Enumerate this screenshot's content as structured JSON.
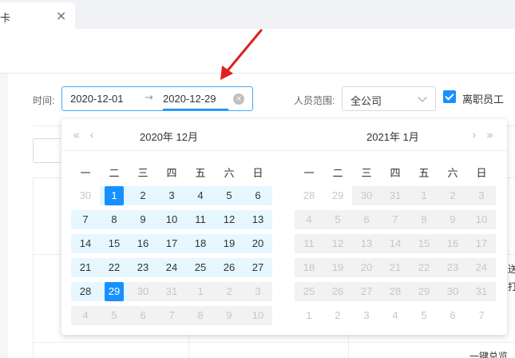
{
  "tab": {
    "label": "卡",
    "close": "×"
  },
  "filters": {
    "time_label": "时间:",
    "start": "2020-12-01",
    "arrow": "→",
    "end": "2020-12-29",
    "clear_icon": "×",
    "scope_label": "人员范围:",
    "scope_value": "全公司",
    "checkbox_label": "离职员工"
  },
  "calendar": {
    "nav_prev_year": "«",
    "nav_prev_month": "‹",
    "nav_next_month": "›",
    "nav_next_year": "»",
    "left_title": "2020年  12月",
    "right_title": "2021年  1月",
    "weekdays": [
      "一",
      "二",
      "三",
      "四",
      "五",
      "六",
      "日"
    ],
    "left_weeks": [
      [
        {
          "d": "30",
          "k": "out"
        },
        {
          "d": "1",
          "k": "sel"
        },
        {
          "d": "2",
          "k": "in"
        },
        {
          "d": "3",
          "k": "in"
        },
        {
          "d": "4",
          "k": "in"
        },
        {
          "d": "5",
          "k": "in"
        },
        {
          "d": "6",
          "k": "in"
        }
      ],
      [
        {
          "d": "7",
          "k": "in"
        },
        {
          "d": "8",
          "k": "in"
        },
        {
          "d": "9",
          "k": "in"
        },
        {
          "d": "10",
          "k": "in"
        },
        {
          "d": "11",
          "k": "in"
        },
        {
          "d": "12",
          "k": "in"
        },
        {
          "d": "13",
          "k": "in"
        }
      ],
      [
        {
          "d": "14",
          "k": "in"
        },
        {
          "d": "15",
          "k": "in"
        },
        {
          "d": "16",
          "k": "in"
        },
        {
          "d": "17",
          "k": "in"
        },
        {
          "d": "18",
          "k": "in"
        },
        {
          "d": "19",
          "k": "in"
        },
        {
          "d": "20",
          "k": "in"
        }
      ],
      [
        {
          "d": "21",
          "k": "in"
        },
        {
          "d": "22",
          "k": "in"
        },
        {
          "d": "23",
          "k": "in"
        },
        {
          "d": "24",
          "k": "in"
        },
        {
          "d": "25",
          "k": "in"
        },
        {
          "d": "26",
          "k": "in"
        },
        {
          "d": "27",
          "k": "in"
        }
      ],
      [
        {
          "d": "28",
          "k": "in"
        },
        {
          "d": "29",
          "k": "sel"
        },
        {
          "d": "30",
          "k": "grey"
        },
        {
          "d": "31",
          "k": "grey"
        },
        {
          "d": "1",
          "k": "out-grey"
        },
        {
          "d": "2",
          "k": "out-grey"
        },
        {
          "d": "3",
          "k": "out-grey"
        }
      ],
      [
        {
          "d": "4",
          "k": "out-grey"
        },
        {
          "d": "5",
          "k": "out-grey"
        },
        {
          "d": "6",
          "k": "out-grey"
        },
        {
          "d": "7",
          "k": "out-grey"
        },
        {
          "d": "8",
          "k": "out-grey"
        },
        {
          "d": "9",
          "k": "out-grey"
        },
        {
          "d": "10",
          "k": "out-grey"
        }
      ]
    ],
    "right_weeks": [
      [
        {
          "d": "28",
          "k": "out"
        },
        {
          "d": "29",
          "k": "out"
        },
        {
          "d": "30",
          "k": "grey"
        },
        {
          "d": "31",
          "k": "grey"
        },
        {
          "d": "1",
          "k": "grey"
        },
        {
          "d": "2",
          "k": "grey"
        },
        {
          "d": "3",
          "k": "grey"
        }
      ],
      [
        {
          "d": "4",
          "k": "grey"
        },
        {
          "d": "5",
          "k": "grey"
        },
        {
          "d": "6",
          "k": "grey"
        },
        {
          "d": "7",
          "k": "grey"
        },
        {
          "d": "8",
          "k": "grey"
        },
        {
          "d": "9",
          "k": "grey"
        },
        {
          "d": "10",
          "k": "grey"
        }
      ],
      [
        {
          "d": "11",
          "k": "grey"
        },
        {
          "d": "12",
          "k": "grey"
        },
        {
          "d": "13",
          "k": "grey"
        },
        {
          "d": "14",
          "k": "grey"
        },
        {
          "d": "15",
          "k": "grey"
        },
        {
          "d": "16",
          "k": "grey"
        },
        {
          "d": "17",
          "k": "grey"
        }
      ],
      [
        {
          "d": "18",
          "k": "grey"
        },
        {
          "d": "19",
          "k": "grey"
        },
        {
          "d": "20",
          "k": "grey"
        },
        {
          "d": "21",
          "k": "grey"
        },
        {
          "d": "22",
          "k": "grey"
        },
        {
          "d": "23",
          "k": "grey"
        },
        {
          "d": "24",
          "k": "grey"
        }
      ],
      [
        {
          "d": "25",
          "k": "grey"
        },
        {
          "d": "26",
          "k": "grey"
        },
        {
          "d": "27",
          "k": "grey"
        },
        {
          "d": "28",
          "k": "grey"
        },
        {
          "d": "29",
          "k": "grey"
        },
        {
          "d": "30",
          "k": "grey"
        },
        {
          "d": "31",
          "k": "grey"
        }
      ],
      [
        {
          "d": "1",
          "k": "out"
        },
        {
          "d": "2",
          "k": "out"
        },
        {
          "d": "3",
          "k": "out"
        },
        {
          "d": "4",
          "k": "out"
        },
        {
          "d": "5",
          "k": "out"
        },
        {
          "d": "6",
          "k": "out"
        },
        {
          "d": "7",
          "k": "out"
        }
      ]
    ]
  },
  "background": {
    "peek1": "送",
    "peek2": "打",
    "peek3": "一键总览"
  },
  "colors": {
    "accent": "#1890ff",
    "range_bg": "#e6f7ff",
    "arrow": "#e02020"
  }
}
